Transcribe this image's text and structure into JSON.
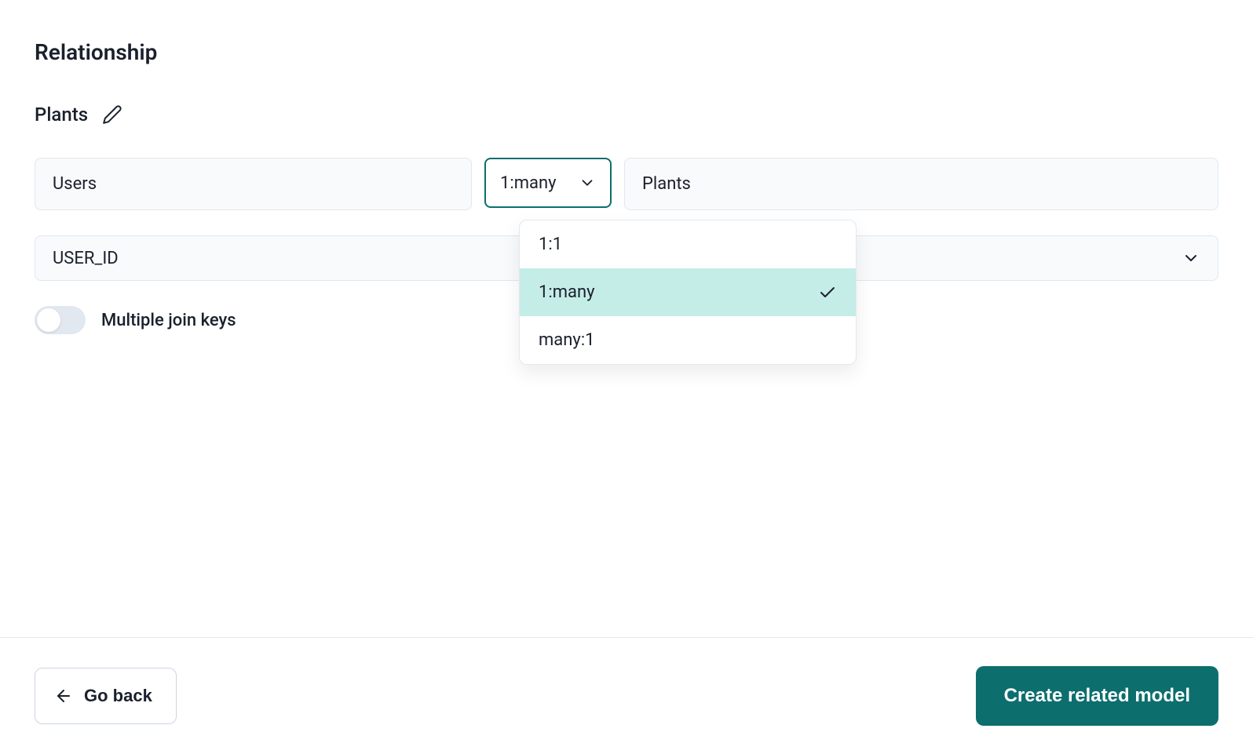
{
  "section": {
    "title": "Relationship"
  },
  "model": {
    "name": "Plants"
  },
  "relationship": {
    "left_model": "Users",
    "right_model": "Plants",
    "cardinality_selected": "1:many",
    "cardinality_options": [
      "1:1",
      "1:many",
      "many:1"
    ],
    "join_key": "USER_ID"
  },
  "toggle": {
    "multiple_join_keys_label": "Multiple join keys",
    "enabled": false
  },
  "footer": {
    "back_label": "Go back",
    "primary_label": "Create related model"
  },
  "colors": {
    "accent": "#0d6e6e",
    "selected_bg": "#c5ede8"
  }
}
